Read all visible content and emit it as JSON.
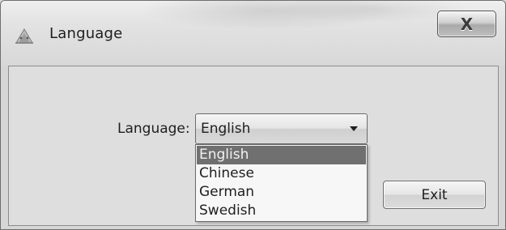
{
  "window": {
    "title": "Language",
    "app_icon": "language-app-icon",
    "close_icon": "close-icon",
    "close_glyph": "X"
  },
  "form": {
    "language_label": "Language:",
    "language_select": {
      "selected": "English",
      "options": [
        "English",
        "Chinese",
        "German",
        "Swedish"
      ],
      "highlighted_option": "English",
      "expanded": true
    },
    "exit_button": "Exit"
  },
  "colors": {
    "highlight": "#707070",
    "window_bg": "#dedede"
  }
}
